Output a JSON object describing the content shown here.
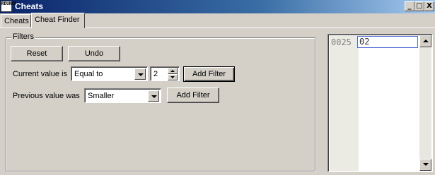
{
  "window": {
    "title": "Cheats",
    "icon_text": "RDUNCE",
    "minimize": "_",
    "maximize": "□",
    "close": "X"
  },
  "tabs": [
    {
      "label": "Cheats",
      "active": false
    },
    {
      "label": "Cheat Finder",
      "active": true
    }
  ],
  "filters": {
    "group_title": "Filters",
    "reset_label": "Reset",
    "undo_label": "Undo",
    "current": {
      "label": "Current value is",
      "comparison": "Equal to",
      "value": "2",
      "add_label": "Add Filter"
    },
    "previous": {
      "label": "Previous value was",
      "comparison": "Smaller",
      "add_label": "Add Filter"
    }
  },
  "hexview": {
    "address": "0025",
    "value": "02"
  }
}
